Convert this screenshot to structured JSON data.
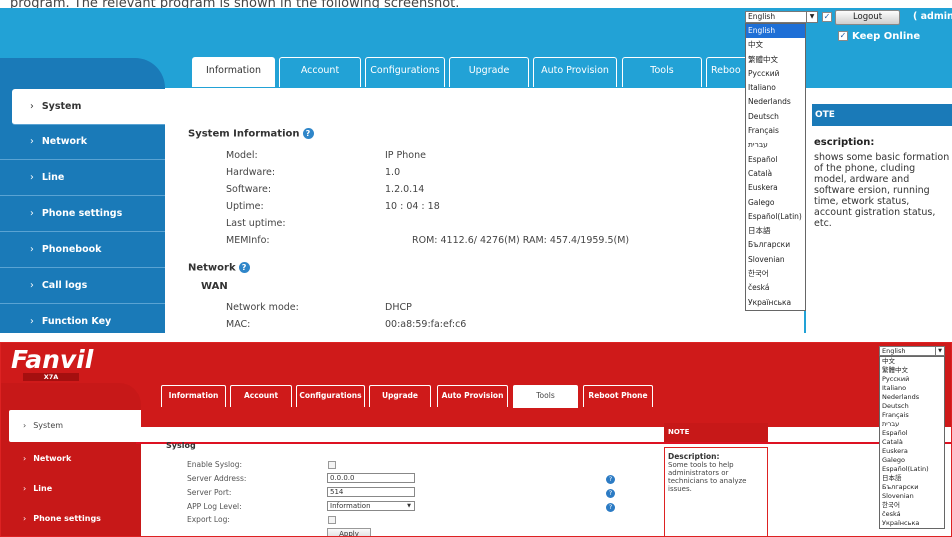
{
  "top": {
    "partial_text": "program. The relevant program is shown in the following screenshot.",
    "tabs": [
      "Information",
      "Account",
      "Configurations",
      "Upgrade",
      "Auto Provision",
      "Tools",
      "Reboo"
    ],
    "sidebar": [
      "System",
      "Network",
      "Line",
      "Phone settings",
      "Phonebook",
      "Call logs",
      "Function Key"
    ],
    "system_info_title": "System Information",
    "info": [
      {
        "label": "Model:",
        "value": "IP Phone"
      },
      {
        "label": "Hardware:",
        "value": "1.0"
      },
      {
        "label": "Software:",
        "value": "1.2.0.14"
      },
      {
        "label": "Uptime:",
        "value": "10 : 04 : 18"
      },
      {
        "label": "Last uptime:",
        "value": ""
      },
      {
        "label": "MEMInfo:",
        "value": "ROM: 4112.6/ 4276(M)    RAM: 457.4/1959.5(M)"
      }
    ],
    "network_title": "Network",
    "wan_title": "WAN",
    "network_rows": [
      {
        "label": "Network mode:",
        "value": "DHCP"
      },
      {
        "label": "MAC:",
        "value": "00:a8:59:fa:ef:c6"
      }
    ],
    "note_head": "OTE",
    "note_title": "escription:",
    "note_text": "shows some basic formation of the phone, cluding model, ardware and software ersion, running time, etwork status, account gistration status, etc.",
    "language_selected": "English",
    "logout_label": "Logout",
    "admin_label": "( admin",
    "keep_online_label": "Keep Online",
    "languages": [
      "English",
      "中文",
      "繁體中文",
      "Русский",
      "Italiano",
      "Nederlands",
      "Deutsch",
      "Français",
      "עברית",
      "Español",
      "Català",
      "Euskera",
      "Galego",
      "Español(Latin)",
      "日本語",
      "Български",
      "Slovenian",
      "한국어",
      "česká",
      "Українська"
    ]
  },
  "bottom": {
    "logo": "Fanvil",
    "model_badge": "X7A",
    "tabs": [
      "Information",
      "Account",
      "Configurations",
      "Upgrade",
      "Auto Provision",
      "Tools",
      "Reboot Phone"
    ],
    "sidebar": [
      "System",
      "Network",
      "Line",
      "Phone settings"
    ],
    "syslog_title": "Syslog",
    "rows": [
      {
        "label": "Enable Syslog:"
      },
      {
        "label": "Server Address:",
        "value": "0.0.0.0"
      },
      {
        "label": "Server Port:",
        "value": "514"
      },
      {
        "label": "APP Log Level:",
        "value": "Information"
      },
      {
        "label": "Export Log:"
      }
    ],
    "apply_label": "Apply",
    "note_head": "NOTE",
    "note_title": "Description:",
    "note_text": "Some tools to help administrators or technicians to analyze issues.",
    "language_selected": "English",
    "languages": [
      "English",
      "中文",
      "繁體中文",
      "Русский",
      "Italiano",
      "Nederlands",
      "Deutsch",
      "Français",
      "עברית",
      "Español",
      "Català",
      "Euskera",
      "Galego",
      "Español(Latin)",
      "日本語",
      "Български",
      "Slovenian",
      "한국어",
      "česká",
      "Українська"
    ]
  }
}
